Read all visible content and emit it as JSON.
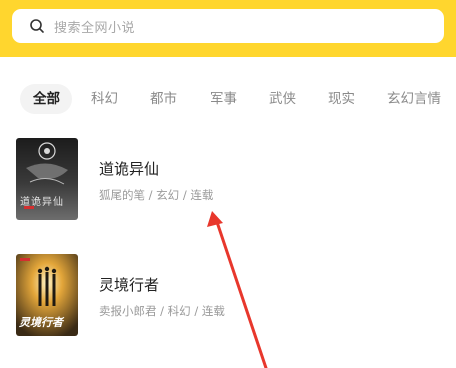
{
  "search": {
    "placeholder": "搜索全网小说",
    "icon": "search-icon"
  },
  "colors": {
    "header": "#ffd62e",
    "active_tab_bg": "#f3f3f3",
    "annotation_arrow": "#e8372c"
  },
  "tabs": [
    {
      "label": "全部",
      "active": true
    },
    {
      "label": "科幻",
      "active": false
    },
    {
      "label": "都市",
      "active": false
    },
    {
      "label": "军事",
      "active": false
    },
    {
      "label": "武侠",
      "active": false
    },
    {
      "label": "现实",
      "active": false
    },
    {
      "label": "玄幻言情",
      "active": false
    }
  ],
  "books": [
    {
      "title": "道诡异仙",
      "meta": "狐尾的笔 / 玄幻 / 连载",
      "cover_text": "道诡异仙"
    },
    {
      "title": "灵境行者",
      "meta": "卖报小郎君 / 科幻 / 连载",
      "cover_text": "灵境行者"
    }
  ]
}
